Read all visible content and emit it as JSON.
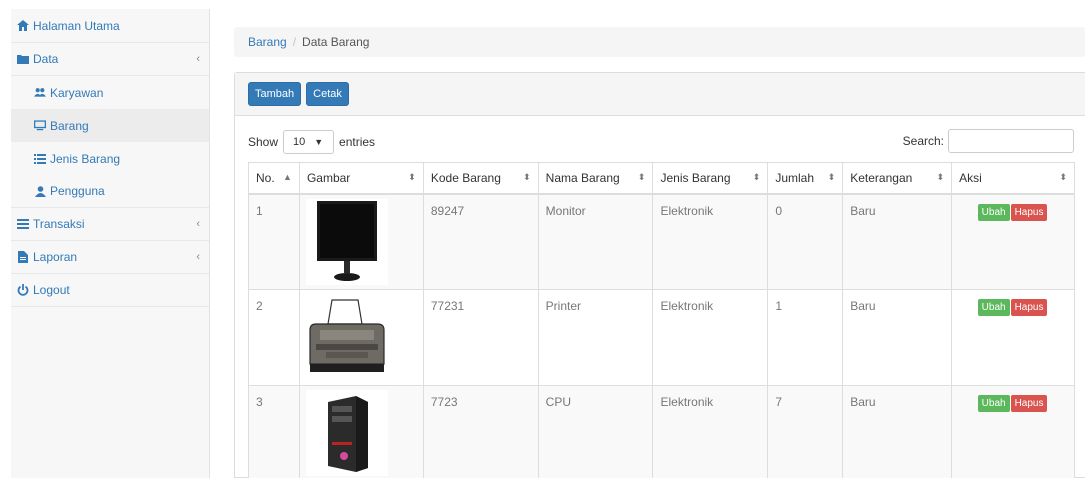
{
  "sidebar": {
    "home": "Halaman Utama",
    "data": "Data",
    "karyawan": "Karyawan",
    "barang": "Barang",
    "jenis_barang": "Jenis Barang",
    "pengguna": "Pengguna",
    "transaksi": "Transaksi",
    "laporan": "Laporan",
    "logout": "Logout"
  },
  "breadcrumb": {
    "parent": "Barang",
    "separator": "/",
    "current": "Data Barang"
  },
  "toolbar": {
    "add_label": "Tambah",
    "print_label": "Cetak"
  },
  "controls": {
    "show_label": "Show",
    "entries_value": "10",
    "entries_label": "entries",
    "search_label": "Search:",
    "search_value": ""
  },
  "table": {
    "headers": [
      "No.",
      "Gambar",
      "Kode Barang",
      "Nama Barang",
      "Jenis Barang",
      "Jumlah",
      "Keterangan",
      "Aksi"
    ],
    "rows": [
      {
        "no": "1",
        "kode": "89247",
        "nama": "Monitor",
        "jenis": "Elektronik",
        "jumlah": "0",
        "ket": "Baru",
        "image": "monitor-image"
      },
      {
        "no": "2",
        "kode": "77231",
        "nama": "Printer",
        "jenis": "Elektronik",
        "jumlah": "1",
        "ket": "Baru",
        "image": "printer-image"
      },
      {
        "no": "3",
        "kode": "7723",
        "nama": "CPU",
        "jenis": "Elektronik",
        "jumlah": "7",
        "ket": "Baru",
        "image": "cpu-image"
      }
    ],
    "edit_label": "Ubah",
    "delete_label": "Hapus"
  },
  "colors": {
    "primary": "#337ab7",
    "success": "#5cb85c",
    "danger": "#d9534f"
  }
}
